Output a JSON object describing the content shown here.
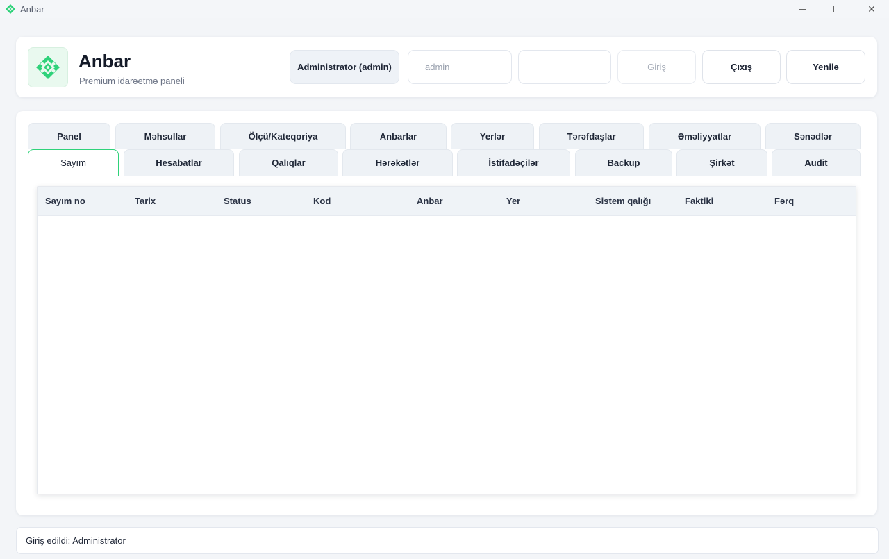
{
  "window": {
    "title": "Anbar",
    "icon": "diamond-logo-icon",
    "controls": [
      "minimize-icon",
      "maximize-icon",
      "close-icon"
    ],
    "close_glyph": "✕"
  },
  "header": {
    "brand_title": "Anbar",
    "brand_subtitle": "Premium idarəetmə paneli",
    "role_label": "Administrator (admin)",
    "username_value": "admin",
    "password_value": "",
    "login_label": "Giriş",
    "logout_label": "Çıxış",
    "refresh_label": "Yenilə",
    "accent_color": "#2fd27a"
  },
  "tabs": {
    "row1": [
      "Panel",
      "Məhsullar",
      "Ölçü/Kateqoriya",
      "Anbarlar",
      "Yerlər",
      "Tərəfdaşlar",
      "Əməliyyatlar",
      "Sənədlər"
    ],
    "row2": [
      "Sayım",
      "Hesabatlar",
      "Qalıqlar",
      "Hərəkətlər",
      "İstifadəçilər",
      "Backup",
      "Şirkət",
      "Audit"
    ],
    "active": "Sayım"
  },
  "table": {
    "columns": [
      "Sayım no",
      "Tarix",
      "Status",
      "Kod",
      "Anbar",
      "Yer",
      "Sistem qalığı",
      "Faktiki",
      "Fərq"
    ],
    "rows": []
  },
  "status_bar": {
    "text": "Giriş edildi: Administrator"
  }
}
